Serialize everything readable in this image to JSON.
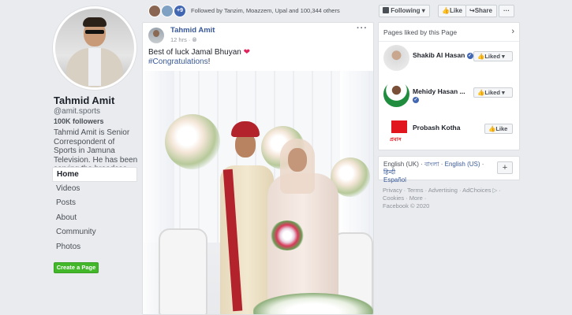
{
  "profile": {
    "name": "Tahmid Amit",
    "handle": "@amit.sports",
    "followers": "100K followers",
    "about": "Tahmid Amit is Senior Correspondent of Sports in Jamuna Television. He has been serving the broadcas..."
  },
  "nav": {
    "items": [
      {
        "label": "Home"
      },
      {
        "label": "Videos"
      },
      {
        "label": "Posts"
      },
      {
        "label": "About"
      },
      {
        "label": "Community"
      },
      {
        "label": "Photos"
      }
    ],
    "create_page": "Create a Page"
  },
  "topbar": {
    "more_count": "+9",
    "followed_text": "Followed by Tanzim, Moazzem, Upal and 100,344 others",
    "following_label": "Following",
    "like_label": "Like",
    "share_label": "Share",
    "more_label": "···"
  },
  "post": {
    "author": "Tahmid Amit",
    "time": "12 hrs ·",
    "text": "Best of luck Jamal Bhuyan",
    "heart": "❤",
    "hashtag": "#Congratulations",
    "hashtag_suffix": "!",
    "dots": "···"
  },
  "pages_liked": {
    "title": "Pages liked by this Page",
    "items": [
      {
        "name": "Shakib Al Hasan",
        "verified": true,
        "button": "Liked"
      },
      {
        "name": "Mehidy Hasan ...",
        "verified": true,
        "button": "Liked"
      },
      {
        "name": "Probash Kotha",
        "verified": false,
        "button": "Like",
        "logo_text": "প্রবাস কথা"
      }
    ]
  },
  "languages": {
    "current": "English (UK)",
    "sep1": " · ",
    "bangla": "বাংলা",
    "sep2": " · ",
    "us": "English (US)",
    "sep3": " · ",
    "hindi": "हिन्दी",
    "spanish": "Español",
    "plus": "+"
  },
  "footer": {
    "line1": "Privacy · Terms · Advertising · AdChoices ▷ ·",
    "line2": "Cookies · More ·",
    "line3": "Facebook © 2020"
  },
  "colors": {
    "link": "#385898",
    "accent": "#4267b2",
    "green": "#42b72a",
    "background": "#e9ebee"
  },
  "icons": [
    "globe-icon",
    "verified-icon",
    "chevron-right-icon",
    "thumbs-up-icon",
    "caret-down-icon",
    "plus-icon"
  ]
}
